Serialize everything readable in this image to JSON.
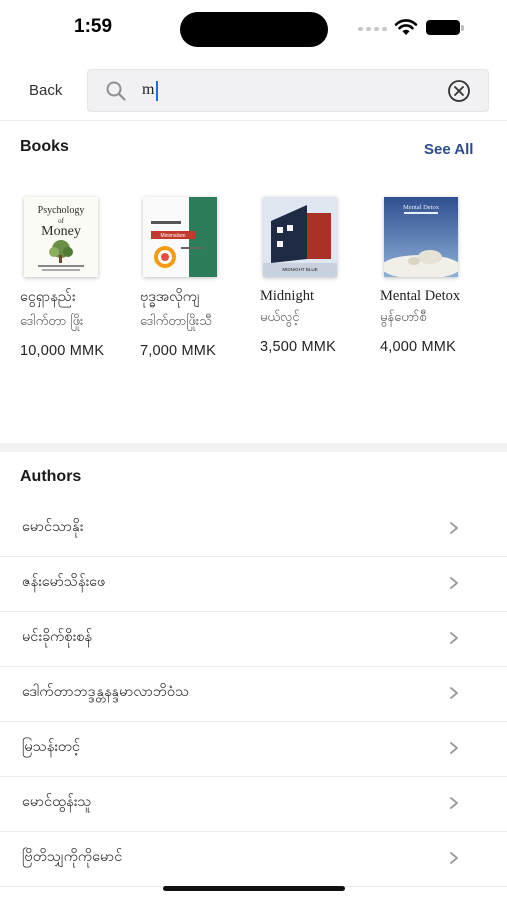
{
  "status": {
    "time": "1:59"
  },
  "header": {
    "back_label": "Back",
    "search_value": "m"
  },
  "books": {
    "title": "Books",
    "see_all": "See All",
    "items": [
      {
        "title": "ငွေရှာနည်း",
        "author": "ဒေါက်တာ ဖြိုး",
        "price": "10,000 MMK",
        "cover_text": "The Psychology of Money"
      },
      {
        "title": "ဗုဒ္ဓအလိုကျ",
        "author": "ဒေါက်တာဖြိုးသီ",
        "price": "7,000 MMK",
        "cover_text": "Minimalism"
      },
      {
        "title": "Midnight",
        "author": "မယ်လွင့်",
        "price": "3,500 MMK",
        "cover_text": "MIDNIGHT BLUE"
      },
      {
        "title": "Mental Detox",
        "author": "မွန်ဟော်စီ",
        "price": "4,000 MMK",
        "cover_text": "Mental Detox"
      }
    ]
  },
  "authors": {
    "title": "Authors",
    "items": [
      "မောင်သာနိုး",
      "ဇန်းမော်သိန်းဖေ",
      "မင်းခိုက်စိုးစန်",
      "ဒေါက်တာဘဒ္ဒန္တနန္ဒမာလာဘိဝံသ",
      "မြသန်းတင့်",
      "မောင်ထွန်းသူ",
      "ဗြိတိသျှကိုကိုမောင်"
    ]
  },
  "colors": {
    "accent": "#2c4d8a",
    "search_bg": "#f1f1f3",
    "divider": "#f2f2f4"
  }
}
